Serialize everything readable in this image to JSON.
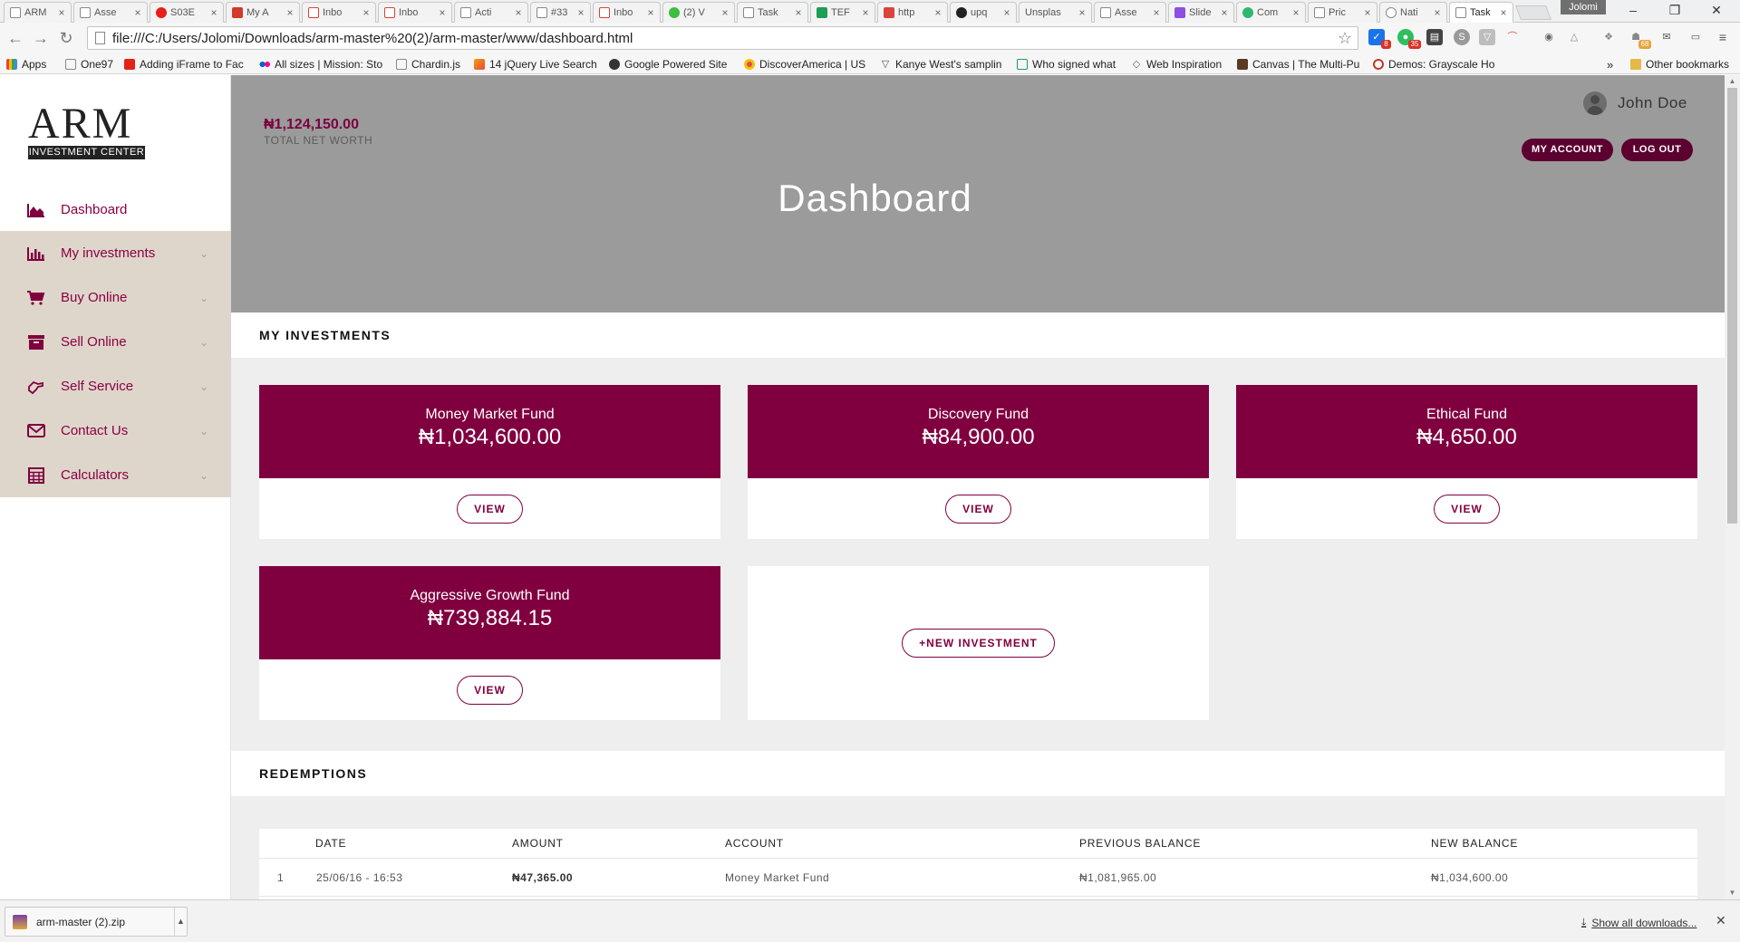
{
  "browser": {
    "tabs": [
      {
        "label": "ARM"
      },
      {
        "label": "Asse"
      },
      {
        "label": "S03E"
      },
      {
        "label": "My A"
      },
      {
        "label": "Inbo"
      },
      {
        "label": "Inbo"
      },
      {
        "label": "Acti"
      },
      {
        "label": "#33"
      },
      {
        "label": "Inbo"
      },
      {
        "label": "(2) V"
      },
      {
        "label": "Task"
      },
      {
        "label": "TEF"
      },
      {
        "label": "http"
      },
      {
        "label": "upq"
      },
      {
        "label": "Unsplas"
      },
      {
        "label": "Asse"
      },
      {
        "label": "Slide"
      },
      {
        "label": "Com"
      },
      {
        "label": "Pric"
      },
      {
        "label": "Nati"
      },
      {
        "label": "Task"
      }
    ],
    "profile_name": "Jolomi",
    "url": "file:///C:/Users/Jolomi/Downloads/arm-master%20(2)/arm-master/www/dashboard.html",
    "extension_badges": {
      "calendar": "8",
      "evernote": "35",
      "misc": "68"
    },
    "bookmarks": [
      {
        "label": "Apps"
      },
      {
        "label": "One97"
      },
      {
        "label": "Adding iFrame to Fac"
      },
      {
        "label": "All sizes | Mission: Sto"
      },
      {
        "label": "Chardin.js"
      },
      {
        "label": "14 jQuery Live Search"
      },
      {
        "label": "Google Powered Site"
      },
      {
        "label": "DiscoverAmerica | US"
      },
      {
        "label": "Kanye West's samplin"
      },
      {
        "label": "Who signed what"
      },
      {
        "label": "Web Inspiration"
      },
      {
        "label": "Canvas | The Multi-Pu"
      },
      {
        "label": "Demos: Grayscale Ho"
      }
    ],
    "bookmarks_overflow": "»",
    "other_bookmarks": "Other bookmarks"
  },
  "sidebar": {
    "logo_letters": "ARM",
    "logo_tagline": "INVESTMENT CENTER",
    "items": [
      {
        "label": "Dashboard",
        "icon": "area-chart-icon"
      },
      {
        "label": "My investments",
        "icon": "bar-chart-icon"
      },
      {
        "label": "Buy Online",
        "icon": "cart-icon"
      },
      {
        "label": "Sell Online",
        "icon": "archive-icon"
      },
      {
        "label": "Self Service",
        "icon": "hand-icon"
      },
      {
        "label": "Contact Us",
        "icon": "envelope-icon"
      },
      {
        "label": "Calculators",
        "icon": "calculator-icon"
      }
    ]
  },
  "header": {
    "net_worth_value": "₦1,124,150.00",
    "net_worth_label": "TOTAL NET WORTH",
    "user_name": "John  Doe",
    "my_account_label": "MY ACCOUNT",
    "logout_label": "LOG OUT",
    "title": "Dashboard"
  },
  "investments": {
    "section_title": "MY INVESTMENTS",
    "funds": [
      {
        "name": "Money Market Fund",
        "value": "₦1,034,600.00",
        "action": "VIEW"
      },
      {
        "name": "Discovery Fund",
        "value": "₦84,900.00",
        "action": "VIEW"
      },
      {
        "name": "Ethical Fund",
        "value": "₦4,650.00",
        "action": "VIEW"
      },
      {
        "name": "Aggressive Growth Fund",
        "value": "₦739,884.15",
        "action": "VIEW"
      }
    ],
    "new_investment_label": "+NEW INVESTMENT"
  },
  "redemptions": {
    "section_title": "REDEMPTIONS",
    "columns": [
      "DATE",
      "AMOUNT",
      "ACCOUNT",
      "PREVIOUS BALANCE",
      "NEW BALANCE"
    ],
    "rows": [
      {
        "index": "1",
        "date": "25/06/16 - 16:53",
        "amount": "₦47,365.00",
        "account": "Money Market Fund",
        "previous_balance": "₦1,081,965.00",
        "new_balance": "₦1,034,600.00"
      }
    ]
  },
  "downloads": {
    "file_name": "arm-master (2).zip",
    "show_all_label": "Show all downloads..."
  },
  "colors": {
    "brand": "#80003f",
    "header_bg": "#9b9b9b",
    "sidebar_shade": "#ded6cb",
    "button_dark": "#5c0030"
  }
}
